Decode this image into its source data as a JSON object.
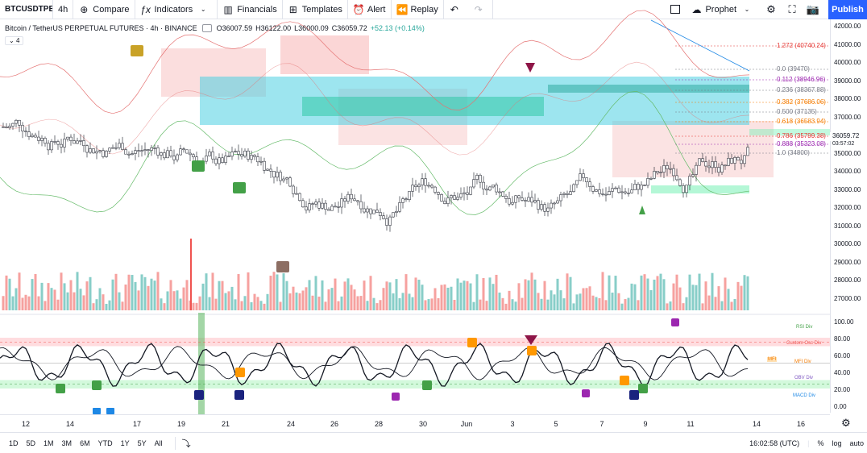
{
  "toolbar": {
    "symbol": "BTCUSDTPEF",
    "interval": "4h",
    "compare": "Compare",
    "indicators": "Indicators",
    "financials": "Financials",
    "templates": "Templates",
    "alert": "Alert",
    "replay": "Replay",
    "layout_name": "Prophet",
    "publish": "Publish"
  },
  "legend": {
    "title": "Bitcoin / TetherUS PERPETUAL FUTURES · 4h · BINANCE",
    "open": "O36007.59",
    "high": "H36122.00",
    "low": "L36000.09",
    "close": "C36059.72",
    "change": "+52.13 (+0.14%)",
    "collapsed_count": "4"
  },
  "price_scale": {
    "ticks": [
      "42000.00",
      "41000.00",
      "40000.00",
      "39000.00",
      "38000.00",
      "37000.00",
      "36000.00",
      "35000.00",
      "34000.00",
      "33000.00",
      "32000.00",
      "31000.00",
      "30000.00",
      "29000.00",
      "28000.00",
      "27000.00"
    ],
    "last_price": "36059.72",
    "countdown": "03:57:02"
  },
  "osc_scale": {
    "ticks": [
      "100.00",
      "80.00",
      "60.00",
      "40.00",
      "20.00",
      "0.00"
    ]
  },
  "fib_levels": [
    {
      "ratio": "1.272",
      "price": "(40740.24)",
      "color": "#e53935"
    },
    {
      "ratio": "0.0",
      "price": "(39470)",
      "color": "#787b86"
    },
    {
      "ratio": "0.112",
      "price": "(38946.96)",
      "color": "#9c27b0"
    },
    {
      "ratio": "0.236",
      "price": "(38367.88)",
      "color": "#787b86"
    },
    {
      "ratio": "0.382",
      "price": "(37686.06)",
      "color": "#f57c00"
    },
    {
      "ratio": "0.500",
      "price": "(37135)",
      "color": "#787b86"
    },
    {
      "ratio": "0.618",
      "price": "(36583.94)",
      "color": "#f57c00"
    },
    {
      "ratio": "0.786",
      "price": "(35799.38)",
      "color": "#e53935"
    },
    {
      "ratio": "0.888",
      "price": "(35323.08)",
      "color": "#9c27b0"
    },
    {
      "ratio": "1.0",
      "price": "(34800)",
      "color": "#787b86"
    }
  ],
  "osc_labels": {
    "rsi_div": "RSI Div",
    "custom_osc_div": "Custom Osc Div",
    "mfi_div": "MFI Div",
    "obv_div": "OBV Div",
    "macd_div": "MACD Div",
    "mfi_marker": "MFI"
  },
  "time_axis": {
    "ticks": [
      "12",
      "14",
      "17",
      "19",
      "21",
      "24",
      "26",
      "28",
      "30",
      "Jun",
      "3",
      "5",
      "7",
      "9",
      "11",
      "14",
      "16"
    ]
  },
  "bottombar": {
    "ranges": [
      "1D",
      "5D",
      "1M",
      "3M",
      "6M",
      "YTD",
      "1Y",
      "5Y",
      "All"
    ],
    "clock": "16:02:58 (UTC)",
    "percent": "%",
    "log": "log",
    "auto": "auto"
  },
  "colors": {
    "accent": "#2962ff",
    "up": "#26a69a",
    "down": "#ef5350"
  }
}
